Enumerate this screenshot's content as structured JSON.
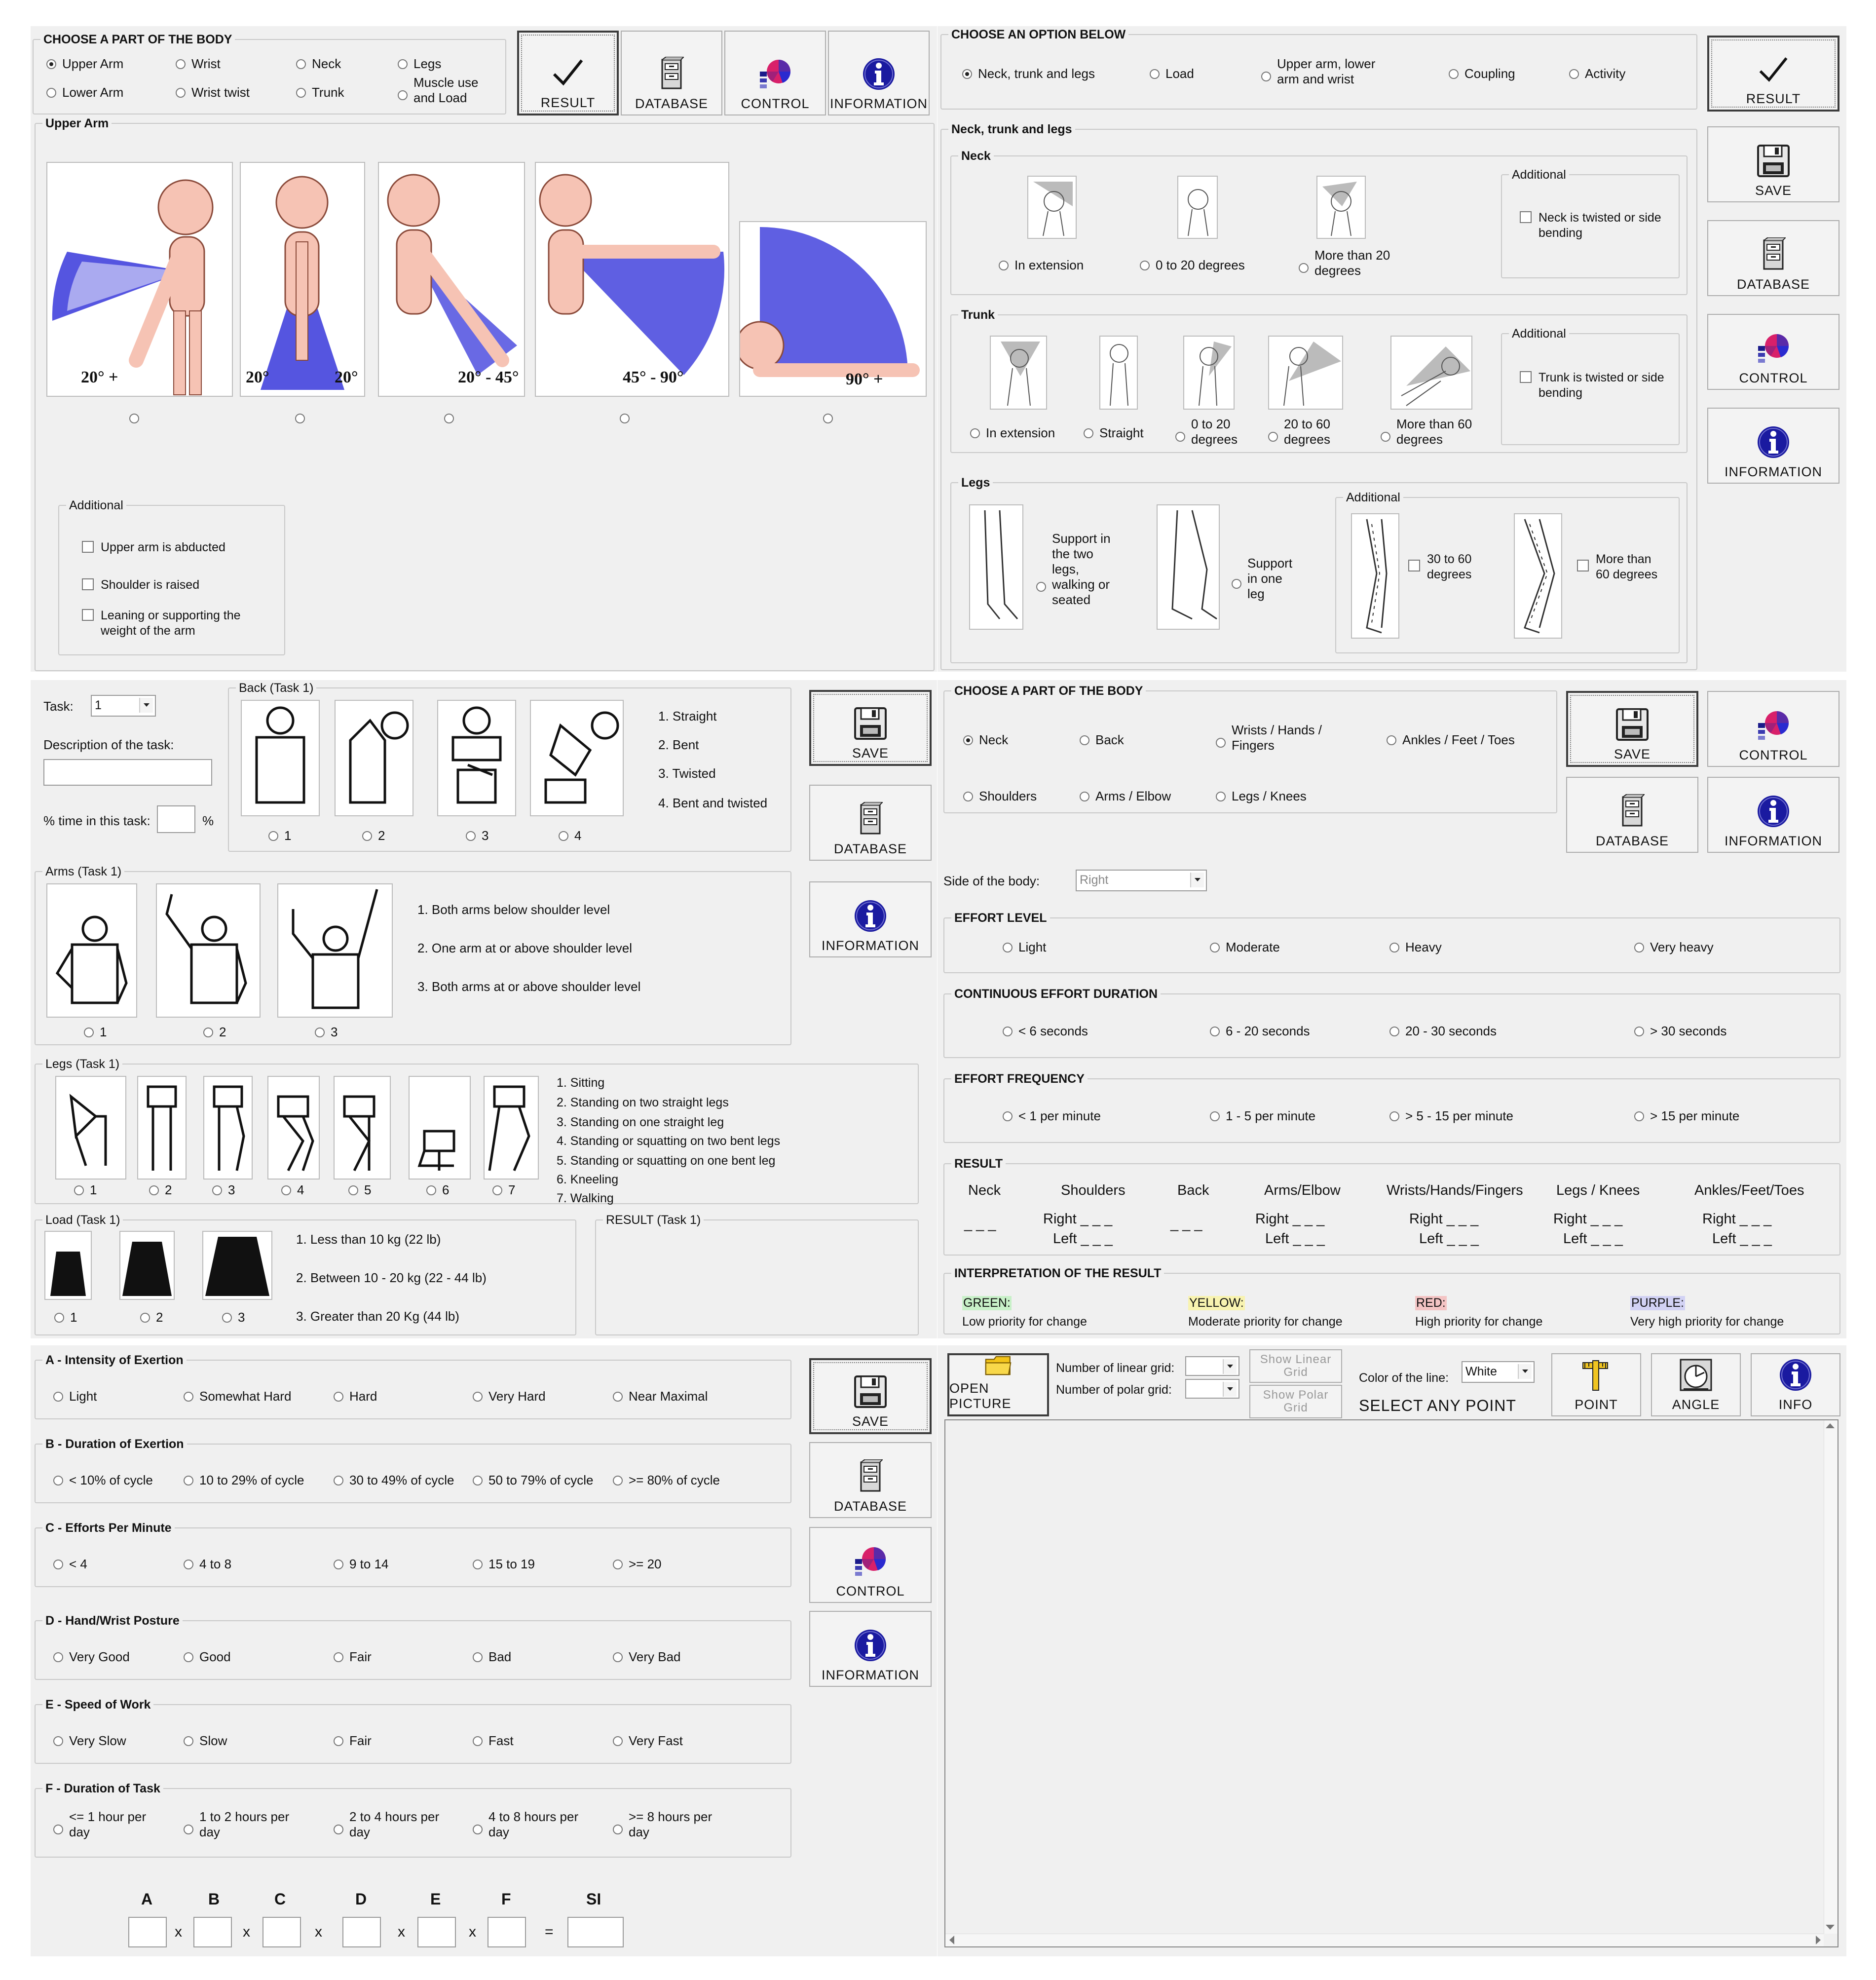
{
  "ul": {
    "choose_title": "CHOOSE A PART OF THE BODY",
    "parts": [
      "Upper Arm",
      "Wrist",
      "Neck",
      "Legs",
      "Lower Arm",
      "Wrist twist",
      "Trunk",
      "Muscle use and Load"
    ],
    "toolbar": [
      "RESULT",
      "DATABASE",
      "CONTROL",
      "INFORMATION"
    ],
    "upper_arm_title": "Upper Arm",
    "angles": [
      "20° +",
      "20°",
      "20°",
      "20° - 45°",
      "45° - 90°",
      "90° +"
    ],
    "additional_title": "Additional",
    "additional": [
      "Upper arm is abducted",
      "Shoulder is raised",
      "Leaning or supporting the weight of the arm"
    ]
  },
  "ur": {
    "choose_title": "CHOOSE AN OPTION BELOW",
    "options": [
      "Neck, trunk and legs",
      "Load",
      "Upper arm, lower arm and wrist",
      "Coupling",
      "Activity"
    ],
    "section_title": "Neck, trunk and legs",
    "neck_title": "Neck",
    "neck": [
      "In extension",
      "0 to 20 degrees",
      "More than 20 degrees"
    ],
    "additional_title": "Additional",
    "neck_additional": "Neck is twisted or side bending",
    "trunk_title": "Trunk",
    "trunk": [
      "In extension",
      "Straight",
      "0 to 20 degrees",
      "20 to 60 degrees",
      "More than 60 degrees"
    ],
    "trunk_additional": "Trunk is twisted or side bending",
    "legs_title": "Legs",
    "legs": [
      "Support in the two legs, walking or seated",
      "Support in one leg"
    ],
    "legs_additional": [
      "30 to 60 degrees",
      "More than 60 degrees"
    ],
    "side_buttons": [
      "RESULT",
      "SAVE",
      "DATABASE",
      "CONTROL",
      "INFORMATION"
    ]
  },
  "ml": {
    "task_label": "Task:",
    "task_value": "1",
    "desc_label": "Description of the task:",
    "time_label": "% time in this task:",
    "pct": "%",
    "back_title": "Back (Task 1)",
    "back_opts": [
      "1",
      "2",
      "3",
      "4"
    ],
    "back_list": [
      "1. Straight",
      "2. Bent",
      "3. Twisted",
      "4. Bent and twisted"
    ],
    "arms_title": "Arms (Task 1)",
    "arms_opts": [
      "1",
      "2",
      "3"
    ],
    "arms_list": [
      "1. Both arms below shoulder level",
      "2. One arm at or above shoulder level",
      "3. Both arms at or above shoulder level"
    ],
    "legs_title": "Legs (Task 1)",
    "legs_opts": [
      "1",
      "2",
      "3",
      "4",
      "5",
      "6",
      "7"
    ],
    "legs_list": [
      "1. Sitting",
      "2. Standing on two straight legs",
      "3. Standing on one straight leg",
      "4. Standing or squatting on two bent legs",
      "5. Standing or squatting on one bent leg",
      "6. Kneeling",
      "7. Walking"
    ],
    "load_title": "Load (Task 1)",
    "load_opts": [
      "1",
      "2",
      "3"
    ],
    "load_list": [
      "1. Less than 10 kg (22 lb)",
      "2. Between 10 - 20 kg (22 - 44 lb)",
      "3. Greater than 20 Kg (44 lb)"
    ],
    "result_title": "RESULT (Task 1)",
    "buttons": [
      "SAVE",
      "DATABASE",
      "INFORMATION"
    ]
  },
  "mr": {
    "choose_title": "CHOOSE A PART OF THE BODY",
    "parts": [
      "Neck",
      "Back",
      "Wrists / Hands / Fingers",
      "Ankles / Feet / Toes",
      "Shoulders",
      "Arms / Elbow",
      "Legs / Knees"
    ],
    "buttons": [
      "SAVE",
      "CONTROL",
      "DATABASE",
      "INFORMATION"
    ],
    "side_label": "Side of the body:",
    "side_value": "Right",
    "effort_title": "EFFORT LEVEL",
    "effort": [
      "Light",
      "Moderate",
      "Heavy",
      "Very heavy"
    ],
    "duration_title": "CONTINUOUS EFFORT DURATION",
    "duration": [
      "< 6 seconds",
      "6 - 20 seconds",
      "20 - 30 seconds",
      "> 30 seconds"
    ],
    "freq_title": "EFFORT FREQUENCY",
    "freq": [
      "< 1 per minute",
      "1 - 5 per minute",
      "> 5 - 15 per minute",
      "> 15 per minute"
    ],
    "result_title": "RESULT",
    "result_cols": [
      "Neck",
      "Shoulders",
      "Back",
      "Arms/Elbow",
      "Wrists/Hands/Fingers",
      "Legs / Knees",
      "Ankles/Feet/Toes"
    ],
    "right": "Right",
    "left": "Left",
    "blank": "_ _ _",
    "interp_title": "INTERPRETATION OF THE RESULT",
    "interp": [
      {
        "label": "GREEN:",
        "text": "Low priority for change",
        "color": "#c8f0c8"
      },
      {
        "label": "YELLOW:",
        "text": "Moderate priority for change",
        "color": "#f8f3b0"
      },
      {
        "label": "RED:",
        "text": "High priority for change",
        "color": "#f4c4c4"
      },
      {
        "label": "PURPLE:",
        "text": "Very high priority for change",
        "color": "#d2d2f4"
      }
    ]
  },
  "ll": {
    "sections": [
      {
        "title": "A - Intensity of Exertion",
        "opts": [
          "Light",
          "Somewhat Hard",
          "Hard",
          "Very Hard",
          "Near Maximal"
        ]
      },
      {
        "title": "B - Duration of Exertion",
        "opts": [
          "< 10% of cycle",
          "10 to 29% of cycle",
          "30 to 49% of cycle",
          "50 to 79% of cycle",
          ">= 80% of cycle"
        ]
      },
      {
        "title": "C - Efforts Per Minute",
        "opts": [
          "< 4",
          "4 to 8",
          "9 to 14",
          "15 to 19",
          ">= 20"
        ]
      },
      {
        "title": "D - Hand/Wrist Posture",
        "opts": [
          "Very Good",
          "Good",
          "Fair",
          "Bad",
          "Very Bad"
        ]
      },
      {
        "title": "E - Speed of Work",
        "opts": [
          "Very Slow",
          "Slow",
          "Fair",
          "Fast",
          "Very Fast"
        ]
      },
      {
        "title": "F - Duration of Task",
        "opts": [
          "<= 1 hour per day",
          "1 to 2 hours per day",
          "2 to 4 hours per day",
          "4 to 8 hours per day",
          ">= 8 hours per day"
        ]
      }
    ],
    "buttons": [
      "SAVE",
      "DATABASE",
      "CONTROL",
      "INFORMATION"
    ],
    "formula_letters": [
      "A",
      "B",
      "C",
      "D",
      "E",
      "F",
      "SI"
    ],
    "times": "x",
    "equals": "="
  },
  "lr": {
    "open_picture": "OPEN PICTURE",
    "linear_grid": "Number of linear grid:",
    "polar_grid": "Number of polar grid:",
    "show_linear": "Show Linear Grid",
    "show_polar": "Show Polar Grid",
    "color_label": "Color of the line:",
    "color_value": "White",
    "select_point": "SELECT ANY POINT",
    "point": "POINT",
    "angle": "ANGLE",
    "info": "INFO"
  },
  "colors": {
    "accent_blue": "#1a1aa0",
    "fan_blue": "#2a2ad8",
    "skin": "#f6c3b4",
    "control_red": "#d8206a",
    "control_purple": "#5a2aa8"
  }
}
